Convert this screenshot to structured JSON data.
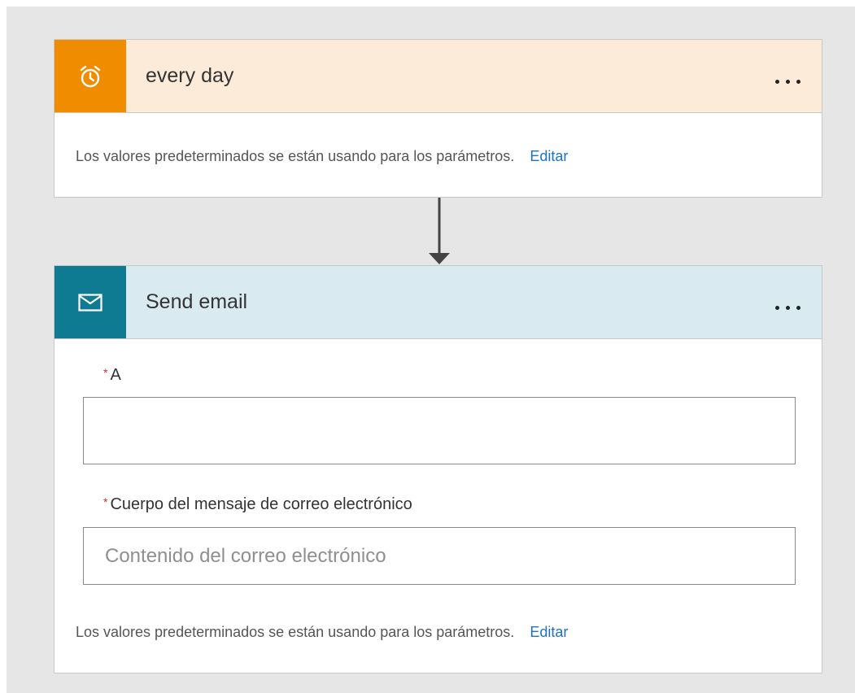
{
  "trigger": {
    "title": "every day",
    "icon": "alarm-clock-icon",
    "more_icon": "ellipsis-icon",
    "defaults_text": "Los valores predeterminados se están usando para los parámetros.",
    "edit_label": "Editar",
    "colors": {
      "header": "#fcebd8",
      "icon_bg": "#ef8c00"
    }
  },
  "action": {
    "title": "Send email",
    "icon": "envelope-icon",
    "more_icon": "ellipsis-icon",
    "fields": {
      "to": {
        "label": "A",
        "required_marker": "*",
        "value": ""
      },
      "body": {
        "label": "Cuerpo del mensaje de correo electrónico",
        "required_marker": "*",
        "placeholder": "Contenido del correo electrónico",
        "value": ""
      }
    },
    "defaults_text": "Los valores predeterminados se están usando para los parámetros.",
    "edit_label": "Editar",
    "colors": {
      "header": "#d9ebf0",
      "icon_bg": "#0f7b92"
    }
  },
  "colors": {
    "link": "#1a73c8",
    "required": "#d0312d",
    "canvas": "#e6e6e6"
  }
}
